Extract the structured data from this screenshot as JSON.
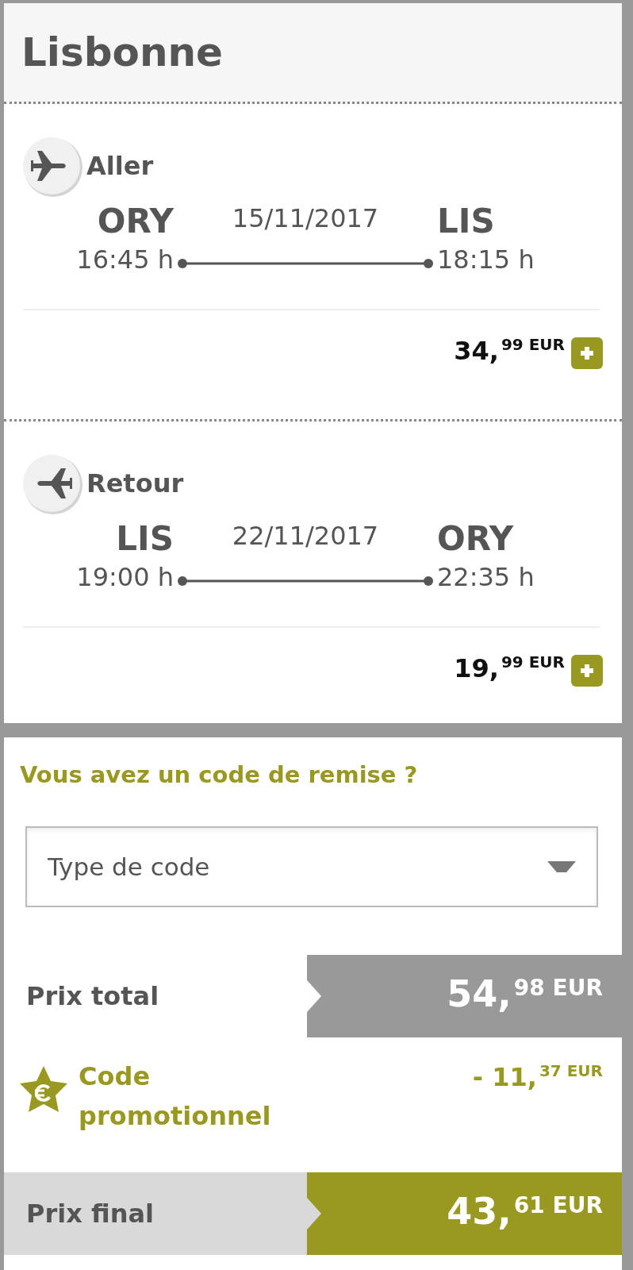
{
  "destination": "Lisbonne",
  "flights": [
    {
      "kind": "outbound",
      "direction": "Aller",
      "date": "15/11/2017",
      "from": {
        "code": "ORY",
        "time": "16:45 h"
      },
      "to": {
        "code": "LIS",
        "time": "18:15 h"
      },
      "price": {
        "whole": "34,",
        "cents": "99",
        "currency": "EUR"
      }
    },
    {
      "kind": "return",
      "direction": "Retour",
      "date": "22/11/2017",
      "from": {
        "code": "LIS",
        "time": "19:00 h"
      },
      "to": {
        "code": "ORY",
        "time": "22:35 h"
      },
      "price": {
        "whole": "19,",
        "cents": "99",
        "currency": "EUR"
      }
    }
  ],
  "discount": {
    "question": "Vous avez un code de remise ?",
    "select": {
      "placeholder": "Type de code"
    }
  },
  "totals": [
    {
      "kind": "total",
      "label": "Prix total",
      "price": {
        "whole": "54,",
        "cents": "98",
        "currency": "EUR"
      }
    },
    {
      "kind": "promo",
      "label": "Code promotionnel",
      "price": {
        "whole": "- 11,",
        "cents": "37",
        "currency": "EUR"
      }
    },
    {
      "kind": "final",
      "label": "Prix final",
      "price": {
        "whole": "43,",
        "cents": "61",
        "currency": "EUR"
      }
    }
  ]
}
